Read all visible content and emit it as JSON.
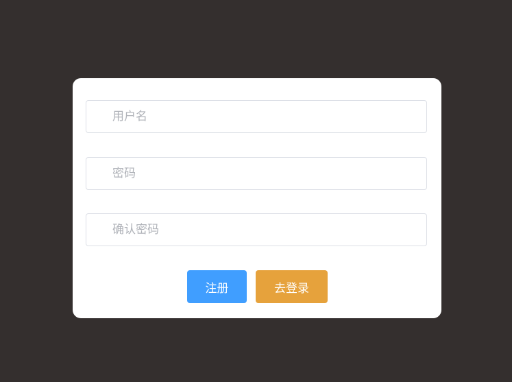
{
  "form": {
    "username_placeholder": "用户名",
    "username_value": "",
    "password_placeholder": "密码",
    "password_value": "",
    "confirm_placeholder": "确认密码",
    "confirm_value": ""
  },
  "buttons": {
    "register_label": "注册",
    "go_login_label": "去登录"
  },
  "colors": {
    "background": "#342f2e",
    "card": "#ffffff",
    "primary": "#409eff",
    "warning": "#e6a23c",
    "border": "#dcdfe6",
    "placeholder": "#b0b3b9"
  }
}
